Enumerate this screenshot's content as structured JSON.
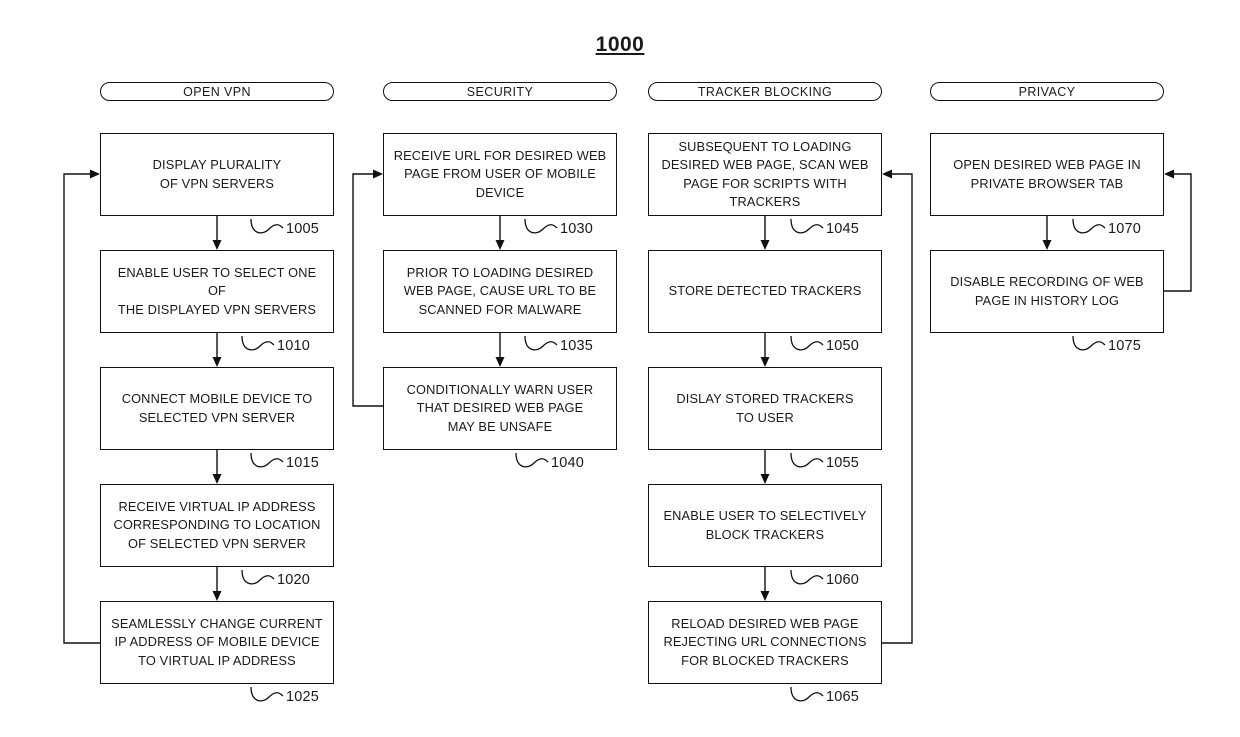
{
  "figure": {
    "number": "1000"
  },
  "columns": [
    {
      "id": "open-vpn",
      "label": "OPEN VPN"
    },
    {
      "id": "security",
      "label": "SECURITY"
    },
    {
      "id": "tracker-blocking",
      "label": "TRACKER BLOCKING"
    },
    {
      "id": "privacy",
      "label": "PRIVACY"
    }
  ],
  "steps": [
    {
      "ref": "1005",
      "column": "open-vpn",
      "text": "DISPLAY PLURALITY\nOF VPN SERVERS"
    },
    {
      "ref": "1010",
      "column": "open-vpn",
      "text": "ENABLE USER TO SELECT ONE OF\nTHE DISPLAYED VPN SERVERS"
    },
    {
      "ref": "1015",
      "column": "open-vpn",
      "text": "CONNECT MOBILE DEVICE TO\nSELECTED VPN SERVER"
    },
    {
      "ref": "1020",
      "column": "open-vpn",
      "text": "RECEIVE VIRTUAL IP ADDRESS\nCORRESPONDING TO LOCATION\nOF SELECTED VPN SERVER"
    },
    {
      "ref": "1025",
      "column": "open-vpn",
      "text": "SEAMLESSLY CHANGE CURRENT\nIP ADDRESS OF MOBILE DEVICE\nTO VIRTUAL IP ADDRESS"
    },
    {
      "ref": "1030",
      "column": "security",
      "text": "RECEIVE URL FOR DESIRED WEB\nPAGE FROM USER OF MOBILE\nDEVICE"
    },
    {
      "ref": "1035",
      "column": "security",
      "text": "PRIOR TO LOADING DESIRED\nWEB PAGE, CAUSE URL TO BE\nSCANNED FOR MALWARE"
    },
    {
      "ref": "1040",
      "column": "security",
      "text": "CONDITIONALLY WARN USER\nTHAT DESIRED WEB PAGE\nMAY BE UNSAFE"
    },
    {
      "ref": "1045",
      "column": "tracker-blocking",
      "text": "SUBSEQUENT TO LOADING\nDESIRED WEB PAGE, SCAN WEB\nPAGE FOR SCRIPTS WITH\nTRACKERS"
    },
    {
      "ref": "1050",
      "column": "tracker-blocking",
      "text": "STORE DETECTED TRACKERS"
    },
    {
      "ref": "1055",
      "column": "tracker-blocking",
      "text": "DISLAY STORED TRACKERS\nTO USER"
    },
    {
      "ref": "1060",
      "column": "tracker-blocking",
      "text": "ENABLE USER TO SELECTIVELY\nBLOCK TRACKERS"
    },
    {
      "ref": "1065",
      "column": "tracker-blocking",
      "text": "RELOAD DESIRED WEB PAGE\nREJECTING URL CONNECTIONS\nFOR BLOCKED TRACKERS"
    },
    {
      "ref": "1070",
      "column": "privacy",
      "text": "OPEN DESIRED WEB PAGE IN\nPRIVATE BROWSER TAB"
    },
    {
      "ref": "1075",
      "column": "privacy",
      "text": "DISABLE RECORDING OF WEB\nPAGE IN HISTORY LOG"
    }
  ],
  "style": {
    "line_color": "#111111",
    "background": "#ffffff"
  }
}
